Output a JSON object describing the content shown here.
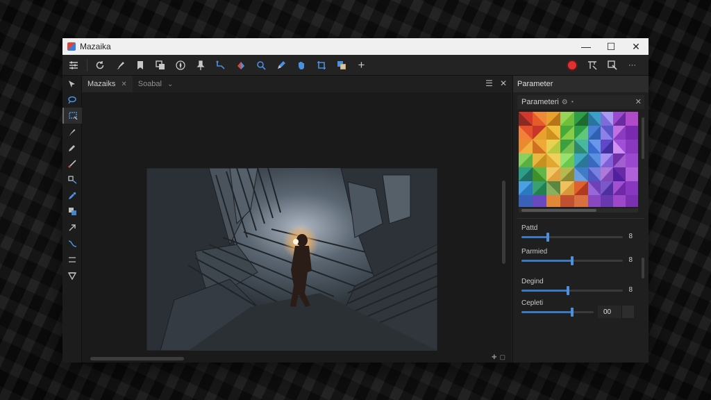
{
  "window": {
    "title": "Mazaika"
  },
  "window_controls": {
    "minimize": "—",
    "maximize": "☐",
    "close": "✕"
  },
  "toolbar": {
    "tools": [
      "sliders-icon",
      "refresh-icon",
      "brush-icon",
      "bookmark-icon",
      "layers-icon",
      "compass-icon",
      "pin-icon",
      "path-icon",
      "fill-icon",
      "zoom-icon",
      "pen-icon",
      "hand-icon",
      "crop-icon",
      "copy-icon",
      "add-icon"
    ],
    "right_tools": [
      "record-icon",
      "transform-icon",
      "export-icon",
      "more-icon"
    ],
    "more": "···",
    "add": "+"
  },
  "left_tools": [
    "select-icon",
    "lasso-icon",
    "rect-select-icon",
    "brush-icon",
    "pencil-icon",
    "line-icon",
    "move-icon",
    "eyedropper-icon",
    "shape-icon",
    "arrow-icon",
    "curve-icon",
    "divider-icon",
    "triangle-icon"
  ],
  "doc_tabs": [
    {
      "label": "Mazaiks",
      "close": "✕",
      "active": true
    },
    {
      "label": "Soabal",
      "close": "⌄",
      "active": false
    }
  ],
  "doc_tab_tools": {
    "menu": "☰",
    "close": "✕"
  },
  "right_panel": {
    "header": "Parameter",
    "sub_header": "Parameteri",
    "sub_close": "✕",
    "params": [
      {
        "label": "Pattd",
        "value": "8",
        "fraction": 0.26
      },
      {
        "label": "Parmied",
        "value": "8",
        "fraction": 0.5
      },
      {
        "label": "Degind",
        "value": "8",
        "fraction": 0.46
      },
      {
        "label": "Cepleti",
        "value": "00",
        "fraction": 0.7
      }
    ]
  },
  "colors": {
    "accent": "#3b78c4",
    "record": "#e03030"
  }
}
